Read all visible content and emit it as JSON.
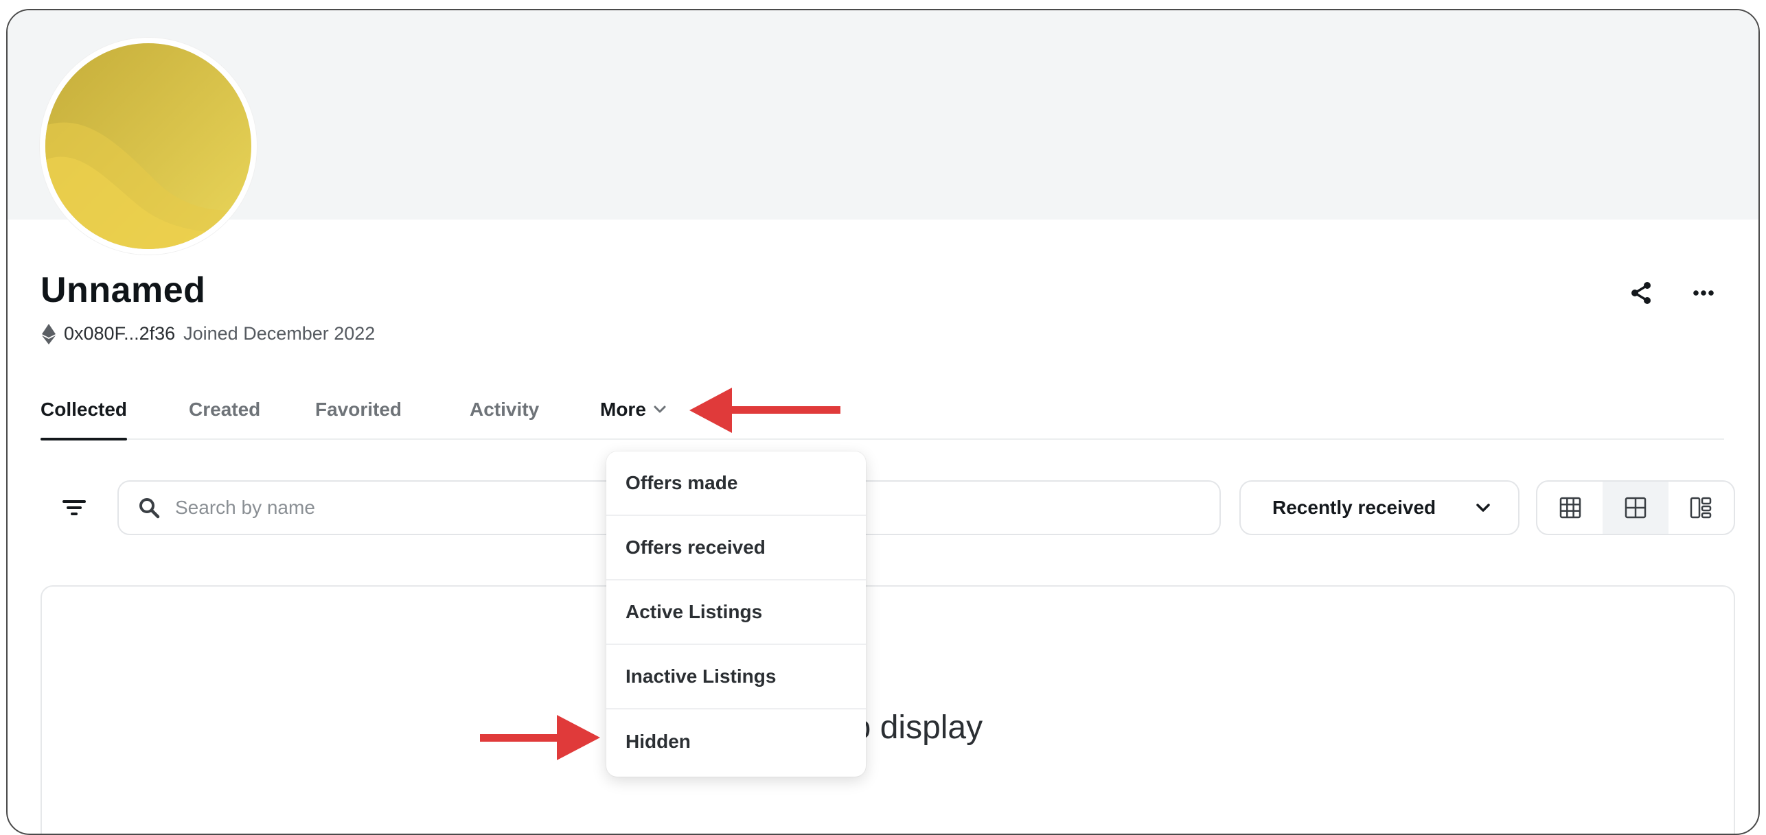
{
  "profile": {
    "name": "Unnamed",
    "address": "0x080F...2f36",
    "joined": "Joined December 2022"
  },
  "header_actions": {
    "share_icon": "share-icon",
    "more_icon": "ellipsis-icon"
  },
  "tabs": [
    {
      "label": "Collected",
      "active": true
    },
    {
      "label": "Created",
      "active": false
    },
    {
      "label": "Favorited",
      "active": false
    },
    {
      "label": "Activity",
      "active": false
    },
    {
      "label": "More",
      "active": false
    }
  ],
  "search": {
    "placeholder": "Search by name",
    "value": ""
  },
  "sort": {
    "selected": "Recently received"
  },
  "view_modes": [
    {
      "icon": "grid-large-icon",
      "active": false
    },
    {
      "icon": "grid-small-icon",
      "active": true
    },
    {
      "icon": "layout-icon",
      "active": false
    }
  ],
  "more_menu": [
    {
      "label": "Offers made"
    },
    {
      "label": "Offers received"
    },
    {
      "label": "Active Listings"
    },
    {
      "label": "Inactive Listings"
    },
    {
      "label": "Hidden"
    }
  ],
  "empty_state": {
    "visible_text": "s to display"
  },
  "colors": {
    "annotation_arrow": "#e03a3a",
    "avatar_gradient_start": "#c9b23a",
    "avatar_gradient_end": "#e8d55a",
    "banner": "#f3f5f6"
  }
}
